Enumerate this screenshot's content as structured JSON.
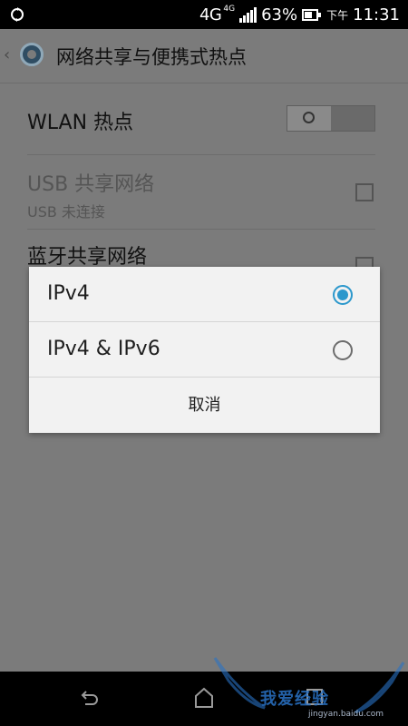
{
  "status_bar": {
    "network": "4G",
    "network_small": "4G",
    "battery": "63%",
    "battery_level": 0.63,
    "time_prefix": "下午",
    "time": "11:31"
  },
  "page": {
    "title": "网络共享与便携式热点",
    "wlan_hotspot": {
      "label": "WLAN 热点",
      "enabled": false
    },
    "usb": {
      "label": "USB 共享网络",
      "sub": "USB 未连接",
      "checked": false
    },
    "bluetooth": {
      "label": "蓝牙共享网络",
      "checked": false
    }
  },
  "dialog": {
    "options": [
      {
        "label": "IPv4",
        "selected": true
      },
      {
        "label": "IPv4 & IPv6",
        "selected": false
      }
    ],
    "cancel": "取消"
  },
  "colors": {
    "accent": "#2c98cc",
    "overlay": "#7b7b7b",
    "dialog_bg": "#f2f2f2"
  },
  "watermark": {
    "text": "我爱经验",
    "url": "jingyan.baidu.com"
  }
}
